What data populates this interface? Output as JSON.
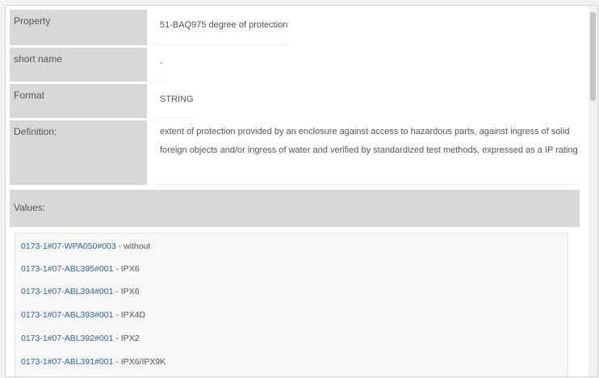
{
  "rows": [
    {
      "label": "Property",
      "value": "51-BAQ975 degree of protection"
    },
    {
      "label": "short name",
      "value": "-"
    },
    {
      "label": "Format",
      "value": "STRING"
    },
    {
      "label": "Definition:",
      "value": "extent of protection provided by an enclosure against access to hazardous parts, against ingress of solid foreign objects and/or ingress of water and verified by standardized test methods, expressed as a IP rating"
    }
  ],
  "values_label": "Values:",
  "values": [
    {
      "code": "0173-1#07-WPA050#003",
      "text": " - without"
    },
    {
      "code": "0173-1#07-ABL395#001",
      "text": " - IPX6"
    },
    {
      "code": "0173-1#07-ABL394#001",
      "text": " - IPX6"
    },
    {
      "code": "0173-1#07-ABL393#001",
      "text": " - IPX4D"
    },
    {
      "code": "0173-1#07-ABL392#001",
      "text": " - IPX2"
    },
    {
      "code": "0173-1#07-ABL391#001",
      "text": " - IPX6/IPX9K"
    }
  ]
}
